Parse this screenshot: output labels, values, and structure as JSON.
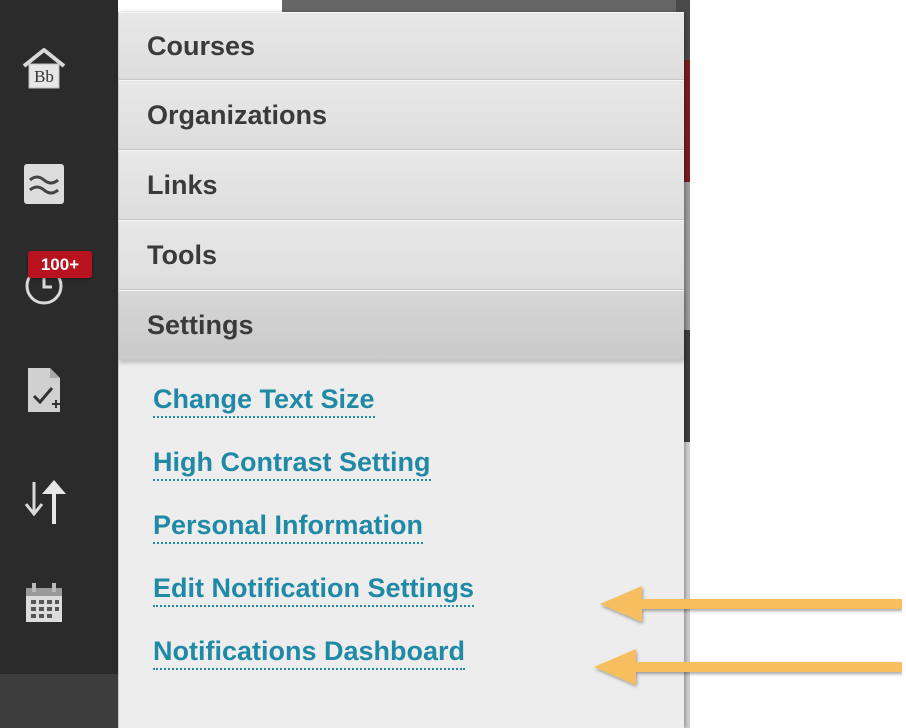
{
  "rail": {
    "badge_count": "100+",
    "icons": [
      "home-icon",
      "waves-icon",
      "clock-icon",
      "grades-icon",
      "updown-icon",
      "calendar-icon"
    ],
    "logo_text": "Bb"
  },
  "menu": {
    "items": [
      {
        "label": "Courses"
      },
      {
        "label": "Organizations"
      },
      {
        "label": "Links"
      },
      {
        "label": "Tools"
      },
      {
        "label": "Settings",
        "active": true
      }
    ]
  },
  "settings_submenu": {
    "links": [
      {
        "label": "Change Text Size"
      },
      {
        "label": "High Contrast Setting"
      },
      {
        "label": "Personal Information"
      },
      {
        "label": "Edit Notification Settings"
      },
      {
        "label": "Notifications Dashboard"
      }
    ]
  },
  "colors": {
    "rail": "#2b2b2b",
    "menu_bg": "#ededed",
    "link": "#2089a6",
    "badge": "#b8121f",
    "arrow": "#f7be5e"
  }
}
